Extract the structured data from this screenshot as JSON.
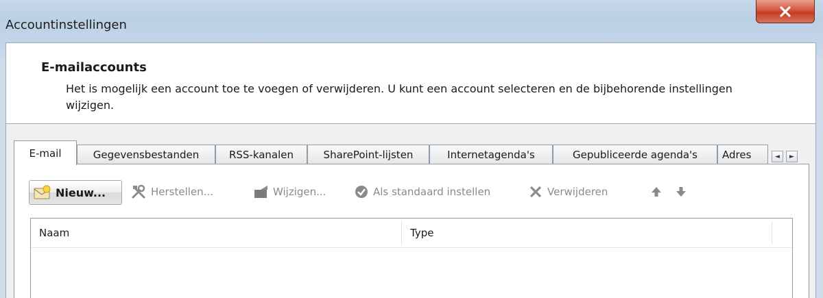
{
  "window": {
    "title": "Accountinstellingen",
    "close_icon": "close-x-icon"
  },
  "header": {
    "title": "E-mailaccounts",
    "description": "Het is mogelijk een account toe te voegen of verwijderen. U kunt een account selecteren en de bijbehorende instellingen wijzigen."
  },
  "tabs": [
    {
      "label": "E-mail",
      "active": true
    },
    {
      "label": "Gegevensbestanden",
      "active": false
    },
    {
      "label": "RSS-kanalen",
      "active": false
    },
    {
      "label": "SharePoint-lijsten",
      "active": false
    },
    {
      "label": "Internetagenda's",
      "active": false
    },
    {
      "label": "Gepubliceerde agenda's",
      "active": false
    },
    {
      "label": "Adres",
      "active": false
    }
  ],
  "tab_scroll": {
    "left": "◄",
    "right": "►"
  },
  "toolbar": {
    "new_label": "Nieuw...",
    "repair_label": "Herstellen...",
    "change_label": "Wijzigen...",
    "default_label": "Als standaard instellen",
    "remove_label": "Verwijderen"
  },
  "table": {
    "columns": [
      "Naam",
      "Type"
    ],
    "rows": []
  },
  "colors": {
    "window_chrome": "#c6d8ea",
    "close_button": "#c23b25",
    "panel_background": "#ffffff",
    "disabled_text": "#8a8a8a"
  }
}
